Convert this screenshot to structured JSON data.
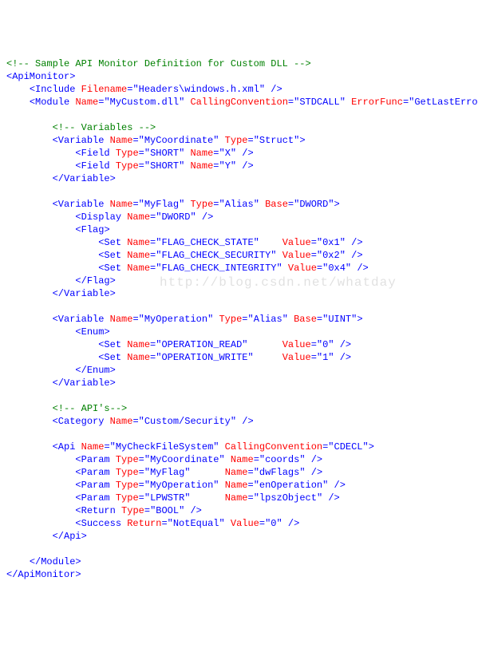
{
  "watermark": "http://blog.csdn.net/whatday",
  "lines": [
    {
      "i": 0,
      "t": "comment",
      "x": "<!-- Sample API Monitor Definition for Custom DLL -->"
    },
    {
      "i": 0,
      "t": "open",
      "tag": "ApiMonitor",
      "attrs": []
    },
    {
      "i": 1,
      "t": "self",
      "tag": "Include",
      "attrs": [
        [
          "Filename",
          "Headers\\windows.h.xml"
        ]
      ]
    },
    {
      "i": 1,
      "t": "open",
      "tag": "Module",
      "attrs": [
        [
          "Name",
          "MyCustom.dll"
        ],
        [
          "CallingConvention",
          "STDCALL"
        ],
        [
          "ErrorFunc",
          "GetLastError"
        ]
      ]
    },
    {
      "i": 0,
      "t": "blank"
    },
    {
      "i": 2,
      "t": "comment",
      "x": "<!-- Variables -->"
    },
    {
      "i": 2,
      "t": "open",
      "tag": "Variable",
      "attrs": [
        [
          "Name",
          "MyCoordinate"
        ],
        [
          "Type",
          "Struct"
        ]
      ]
    },
    {
      "i": 3,
      "t": "self",
      "tag": "Field",
      "attrs": [
        [
          "Type",
          "SHORT"
        ],
        [
          "Name",
          "X"
        ]
      ],
      "cols": [
        19,
        31
      ]
    },
    {
      "i": 3,
      "t": "self",
      "tag": "Field",
      "attrs": [
        [
          "Type",
          "SHORT"
        ],
        [
          "Name",
          "Y"
        ]
      ],
      "cols": [
        19,
        31
      ]
    },
    {
      "i": 2,
      "t": "close",
      "tag": "Variable"
    },
    {
      "i": 0,
      "t": "blank"
    },
    {
      "i": 2,
      "t": "open",
      "tag": "Variable",
      "attrs": [
        [
          "Name",
          "MyFlag"
        ],
        [
          "Type",
          "Alias"
        ],
        [
          "Base",
          "DWORD"
        ]
      ]
    },
    {
      "i": 3,
      "t": "self",
      "tag": "Display",
      "attrs": [
        [
          "Name",
          "DWORD"
        ]
      ]
    },
    {
      "i": 3,
      "t": "open",
      "tag": "Flag",
      "attrs": []
    },
    {
      "i": 4,
      "t": "self",
      "tag": "Set",
      "attrs": [
        [
          "Name",
          "FLAG_CHECK_STATE"
        ],
        [
          "Value",
          "0x1"
        ]
      ],
      "cols": [
        32,
        57
      ]
    },
    {
      "i": 4,
      "t": "self",
      "tag": "Set",
      "attrs": [
        [
          "Name",
          "FLAG_CHECK_SECURITY"
        ],
        [
          "Value",
          "0x2"
        ]
      ],
      "cols": [
        32,
        57
      ]
    },
    {
      "i": 4,
      "t": "self",
      "tag": "Set",
      "attrs": [
        [
          "Name",
          "FLAG_CHECK_INTEGRITY"
        ],
        [
          "Value",
          "0x4"
        ]
      ],
      "cols": [
        32,
        57
      ]
    },
    {
      "i": 3,
      "t": "close",
      "tag": "Flag"
    },
    {
      "i": 2,
      "t": "close",
      "tag": "Variable"
    },
    {
      "i": 0,
      "t": "blank"
    },
    {
      "i": 2,
      "t": "open",
      "tag": "Variable",
      "attrs": [
        [
          "Name",
          "MyOperation"
        ],
        [
          "Type",
          "Alias"
        ],
        [
          "Base",
          "UINT"
        ]
      ]
    },
    {
      "i": 3,
      "t": "open",
      "tag": "Enum",
      "attrs": []
    },
    {
      "i": 4,
      "t": "self",
      "tag": "Set",
      "attrs": [
        [
          "Name",
          "OPERATION_READ"
        ],
        [
          "Value",
          "0"
        ]
      ],
      "cols": [
        32,
        57
      ]
    },
    {
      "i": 4,
      "t": "self",
      "tag": "Set",
      "attrs": [
        [
          "Name",
          "OPERATION_WRITE"
        ],
        [
          "Value",
          "1"
        ]
      ],
      "cols": [
        32,
        57
      ]
    },
    {
      "i": 3,
      "t": "close",
      "tag": "Enum"
    },
    {
      "i": 2,
      "t": "close",
      "tag": "Variable"
    },
    {
      "i": 0,
      "t": "blank"
    },
    {
      "i": 2,
      "t": "comment",
      "x": "<!-- API's-->"
    },
    {
      "i": 2,
      "t": "self",
      "tag": "Category",
      "attrs": [
        [
          "Name",
          "Custom/Security"
        ]
      ]
    },
    {
      "i": 0,
      "t": "blank"
    },
    {
      "i": 2,
      "t": "open",
      "tag": "Api",
      "attrs": [
        [
          "Name",
          "MyCheckFileSystem"
        ],
        [
          "CallingConvention",
          "CDECL"
        ]
      ]
    },
    {
      "i": 3,
      "t": "self",
      "tag": "Param",
      "attrs": [
        [
          "Type",
          "MyCoordinate"
        ],
        [
          "Name",
          "coords"
        ]
      ],
      "cols": [
        26,
        43
      ]
    },
    {
      "i": 3,
      "t": "self",
      "tag": "Param",
      "attrs": [
        [
          "Type",
          "MyFlag"
        ],
        [
          "Name",
          "dwFlags"
        ]
      ],
      "cols": [
        26,
        43
      ]
    },
    {
      "i": 3,
      "t": "self",
      "tag": "Param",
      "attrs": [
        [
          "Type",
          "MyOperation"
        ],
        [
          "Name",
          "enOperation"
        ]
      ],
      "cols": [
        26,
        43
      ]
    },
    {
      "i": 3,
      "t": "self",
      "tag": "Param",
      "attrs": [
        [
          "Type",
          "LPWSTR"
        ],
        [
          "Name",
          "lpszObject"
        ]
      ],
      "cols": [
        26,
        43
      ]
    },
    {
      "i": 3,
      "t": "self",
      "tag": "Return",
      "attrs": [
        [
          "Type",
          "BOOL"
        ]
      ]
    },
    {
      "i": 3,
      "t": "self",
      "tag": "Success",
      "attrs": [
        [
          "Return",
          "NotEqual"
        ],
        [
          "Value",
          "0"
        ]
      ]
    },
    {
      "i": 2,
      "t": "close",
      "tag": "Api"
    },
    {
      "i": 0,
      "t": "blank"
    },
    {
      "i": 1,
      "t": "close",
      "tag": "Module"
    },
    {
      "i": 0,
      "t": "close",
      "tag": "ApiMonitor"
    }
  ]
}
